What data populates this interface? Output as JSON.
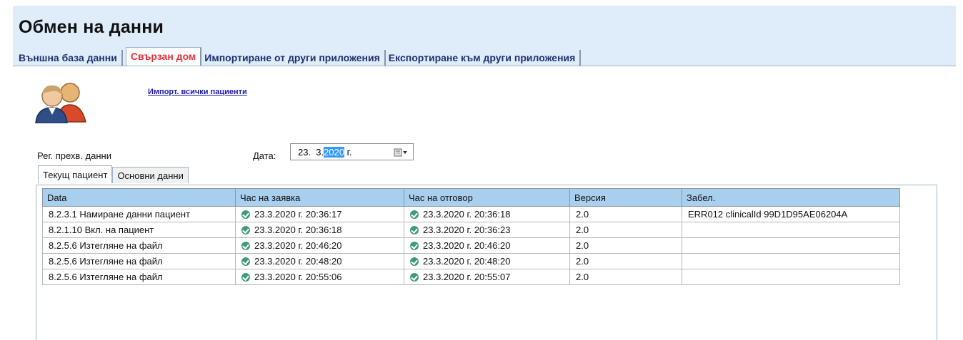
{
  "page": {
    "title": "Обмен на данни"
  },
  "tabs": [
    {
      "label": "Външна база данни",
      "active": false
    },
    {
      "label": "Свързан дом",
      "active": true
    },
    {
      "label": "Импортиране от други приложения",
      "active": false
    },
    {
      "label": "Експортиране към други приложения",
      "active": false
    }
  ],
  "actions": {
    "import_all": "Импорт. всички пациенти"
  },
  "filter": {
    "reg_label": "Рег. прехв. данни",
    "date_label": "Дата:",
    "date_prefix": "23.  3.",
    "date_year": "2020",
    "date_suffix": " г."
  },
  "subtabs": [
    {
      "label": "Текущ пациент",
      "active": true
    },
    {
      "label": "Основни данни",
      "active": false
    }
  ],
  "table": {
    "columns": [
      "Data",
      "Час на заявка",
      "Час на отговор",
      "Версия",
      "Забел."
    ],
    "rows": [
      {
        "data": "8.2.3.1 Намиране данни пациент",
        "request": "23.3.2020 г. 20:36:17",
        "response": "23.3.2020 г. 20:36:18",
        "version": "2.0",
        "note": "ERR012 clinicalId 99D1D95AE06204A"
      },
      {
        "data": "8.2.1.10 Вкл. на пациент",
        "request": "23.3.2020 г. 20:36:18",
        "response": "23.3.2020 г. 20:36:23",
        "version": "2.0",
        "note": ""
      },
      {
        "data": "8.2.5.6 Изтегляне на файл",
        "request": "23.3.2020 г. 20:46:20",
        "response": "23.3.2020 г. 20:46:20",
        "version": "2.0",
        "note": ""
      },
      {
        "data": "8.2.5.6 Изтегляне на файл",
        "request": "23.3.2020 г. 20:48:20",
        "response": "23.3.2020 г. 20:48:20",
        "version": "2.0",
        "note": ""
      },
      {
        "data": "8.2.5.6 Изтегляне на файл",
        "request": "23.3.2020 г. 20:55:06",
        "response": "23.3.2020 г. 20:55:07",
        "version": "2.0",
        "note": ""
      }
    ]
  },
  "icons": {
    "avatar": "users-icon",
    "status": "check-circle-icon",
    "calendar": "calendar-dropdown-icon"
  },
  "colors": {
    "background": "#deedf9",
    "active_tab": "#e0333a",
    "header": "#a9cfee",
    "status_ok": "#3e9b77",
    "selection": "#3399ff"
  }
}
